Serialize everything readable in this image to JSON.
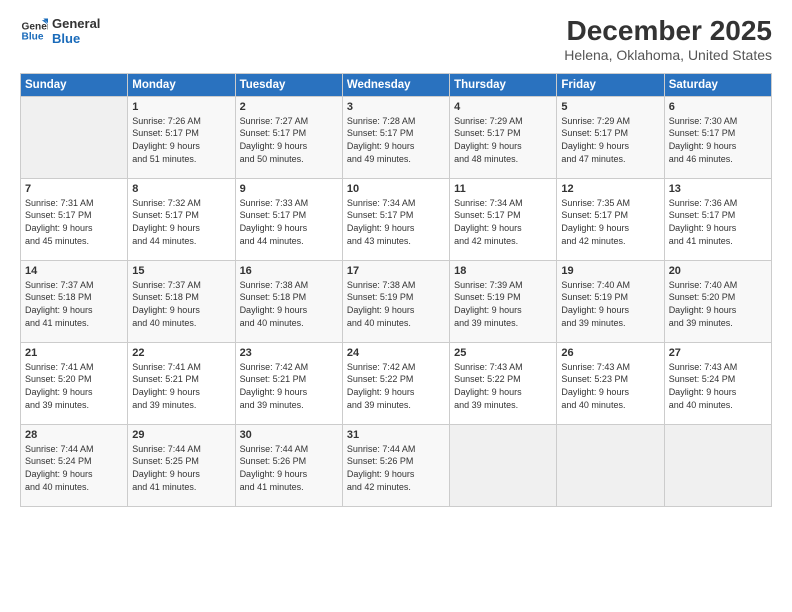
{
  "logo": {
    "line1": "General",
    "line2": "Blue"
  },
  "title": "December 2025",
  "location": "Helena, Oklahoma, United States",
  "days_header": [
    "Sunday",
    "Monday",
    "Tuesday",
    "Wednesday",
    "Thursday",
    "Friday",
    "Saturday"
  ],
  "weeks": [
    [
      {
        "num": "",
        "info": ""
      },
      {
        "num": "1",
        "info": "Sunrise: 7:26 AM\nSunset: 5:17 PM\nDaylight: 9 hours\nand 51 minutes."
      },
      {
        "num": "2",
        "info": "Sunrise: 7:27 AM\nSunset: 5:17 PM\nDaylight: 9 hours\nand 50 minutes."
      },
      {
        "num": "3",
        "info": "Sunrise: 7:28 AM\nSunset: 5:17 PM\nDaylight: 9 hours\nand 49 minutes."
      },
      {
        "num": "4",
        "info": "Sunrise: 7:29 AM\nSunset: 5:17 PM\nDaylight: 9 hours\nand 48 minutes."
      },
      {
        "num": "5",
        "info": "Sunrise: 7:29 AM\nSunset: 5:17 PM\nDaylight: 9 hours\nand 47 minutes."
      },
      {
        "num": "6",
        "info": "Sunrise: 7:30 AM\nSunset: 5:17 PM\nDaylight: 9 hours\nand 46 minutes."
      }
    ],
    [
      {
        "num": "7",
        "info": "Sunrise: 7:31 AM\nSunset: 5:17 PM\nDaylight: 9 hours\nand 45 minutes."
      },
      {
        "num": "8",
        "info": "Sunrise: 7:32 AM\nSunset: 5:17 PM\nDaylight: 9 hours\nand 44 minutes."
      },
      {
        "num": "9",
        "info": "Sunrise: 7:33 AM\nSunset: 5:17 PM\nDaylight: 9 hours\nand 44 minutes."
      },
      {
        "num": "10",
        "info": "Sunrise: 7:34 AM\nSunset: 5:17 PM\nDaylight: 9 hours\nand 43 minutes."
      },
      {
        "num": "11",
        "info": "Sunrise: 7:34 AM\nSunset: 5:17 PM\nDaylight: 9 hours\nand 42 minutes."
      },
      {
        "num": "12",
        "info": "Sunrise: 7:35 AM\nSunset: 5:17 PM\nDaylight: 9 hours\nand 42 minutes."
      },
      {
        "num": "13",
        "info": "Sunrise: 7:36 AM\nSunset: 5:17 PM\nDaylight: 9 hours\nand 41 minutes."
      }
    ],
    [
      {
        "num": "14",
        "info": "Sunrise: 7:37 AM\nSunset: 5:18 PM\nDaylight: 9 hours\nand 41 minutes."
      },
      {
        "num": "15",
        "info": "Sunrise: 7:37 AM\nSunset: 5:18 PM\nDaylight: 9 hours\nand 40 minutes."
      },
      {
        "num": "16",
        "info": "Sunrise: 7:38 AM\nSunset: 5:18 PM\nDaylight: 9 hours\nand 40 minutes."
      },
      {
        "num": "17",
        "info": "Sunrise: 7:38 AM\nSunset: 5:19 PM\nDaylight: 9 hours\nand 40 minutes."
      },
      {
        "num": "18",
        "info": "Sunrise: 7:39 AM\nSunset: 5:19 PM\nDaylight: 9 hours\nand 39 minutes."
      },
      {
        "num": "19",
        "info": "Sunrise: 7:40 AM\nSunset: 5:19 PM\nDaylight: 9 hours\nand 39 minutes."
      },
      {
        "num": "20",
        "info": "Sunrise: 7:40 AM\nSunset: 5:20 PM\nDaylight: 9 hours\nand 39 minutes."
      }
    ],
    [
      {
        "num": "21",
        "info": "Sunrise: 7:41 AM\nSunset: 5:20 PM\nDaylight: 9 hours\nand 39 minutes."
      },
      {
        "num": "22",
        "info": "Sunrise: 7:41 AM\nSunset: 5:21 PM\nDaylight: 9 hours\nand 39 minutes."
      },
      {
        "num": "23",
        "info": "Sunrise: 7:42 AM\nSunset: 5:21 PM\nDaylight: 9 hours\nand 39 minutes."
      },
      {
        "num": "24",
        "info": "Sunrise: 7:42 AM\nSunset: 5:22 PM\nDaylight: 9 hours\nand 39 minutes."
      },
      {
        "num": "25",
        "info": "Sunrise: 7:43 AM\nSunset: 5:22 PM\nDaylight: 9 hours\nand 39 minutes."
      },
      {
        "num": "26",
        "info": "Sunrise: 7:43 AM\nSunset: 5:23 PM\nDaylight: 9 hours\nand 40 minutes."
      },
      {
        "num": "27",
        "info": "Sunrise: 7:43 AM\nSunset: 5:24 PM\nDaylight: 9 hours\nand 40 minutes."
      }
    ],
    [
      {
        "num": "28",
        "info": "Sunrise: 7:44 AM\nSunset: 5:24 PM\nDaylight: 9 hours\nand 40 minutes."
      },
      {
        "num": "29",
        "info": "Sunrise: 7:44 AM\nSunset: 5:25 PM\nDaylight: 9 hours\nand 41 minutes."
      },
      {
        "num": "30",
        "info": "Sunrise: 7:44 AM\nSunset: 5:26 PM\nDaylight: 9 hours\nand 41 minutes."
      },
      {
        "num": "31",
        "info": "Sunrise: 7:44 AM\nSunset: 5:26 PM\nDaylight: 9 hours\nand 42 minutes."
      },
      {
        "num": "",
        "info": ""
      },
      {
        "num": "",
        "info": ""
      },
      {
        "num": "",
        "info": ""
      }
    ]
  ]
}
